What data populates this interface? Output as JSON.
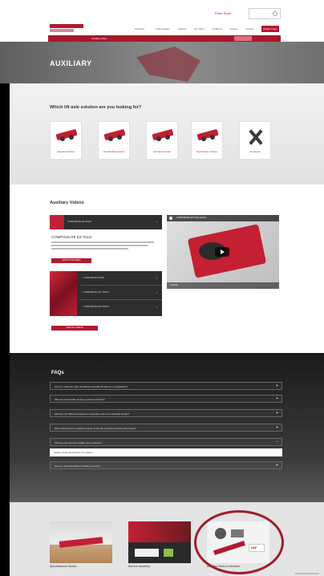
{
  "header": {
    "top_link": "Parts Store",
    "search_placeholder": "",
    "logo_text": "",
    "nav": [
      "Products",
      "Technologies",
      "Support",
      "Our Story",
      "Locations",
      "Careers",
      "Contact"
    ],
    "cta": "Dealer Login"
  },
  "subnav": {
    "label": "Auxiliary Axles"
  },
  "hero": {
    "title": "AUXILIARY"
  },
  "solutions": {
    "title": "Which lift axle solution are you looking for?",
    "cards": [
      {
        "label": "Steerable Lift Axles"
      },
      {
        "label": "Non-Steerable Lift Axles"
      },
      {
        "label": "Self-Steer Lift Axles"
      },
      {
        "label": "Tag & Pusher Lift Axles"
      },
      {
        "label": "Accessories"
      }
    ]
  },
  "videos": {
    "title": "Auxiliary Videos",
    "featured_tile": "COMPOSILITE EZ TRACK",
    "desc_title": "COMPOSILITE EZ Track",
    "watch_btn": "WATCH THE VIDEO",
    "group_items": [
      "COMPOSILITE TRACK",
      "COMPOSILITE AUX TRACK",
      "COMPOSILITE AUX TRACK"
    ],
    "view_all_btn": "VIEW ALL VIDEOS",
    "player_title": "COMPOSILITE EZ Track Lift Axle",
    "player_footer": "YouTube"
  },
  "faqs": {
    "title": "FAQs",
    "items": [
      "How do I select the right Hendrickson auxiliary lift axle for my application?",
      "What are the benefits of using a self-steer lift axle?",
      "What are the differences between a steerable and a non-steerable lift axle?",
      "What maintenance is required to keep my lift axle operating at peak performance?",
      "What are the common auxiliary axle problems?",
      "How do I find Hendrickson Auxiliary products?"
    ],
    "answer": "Please contact Hendrickson for support."
  },
  "resources": {
    "items": [
      {
        "caption": "Specifications Guides"
      },
      {
        "caption": "Service Academy"
      },
      {
        "caption": "Auxiliary Parts & Literature"
      }
    ],
    "brand_mark": "HAP"
  }
}
